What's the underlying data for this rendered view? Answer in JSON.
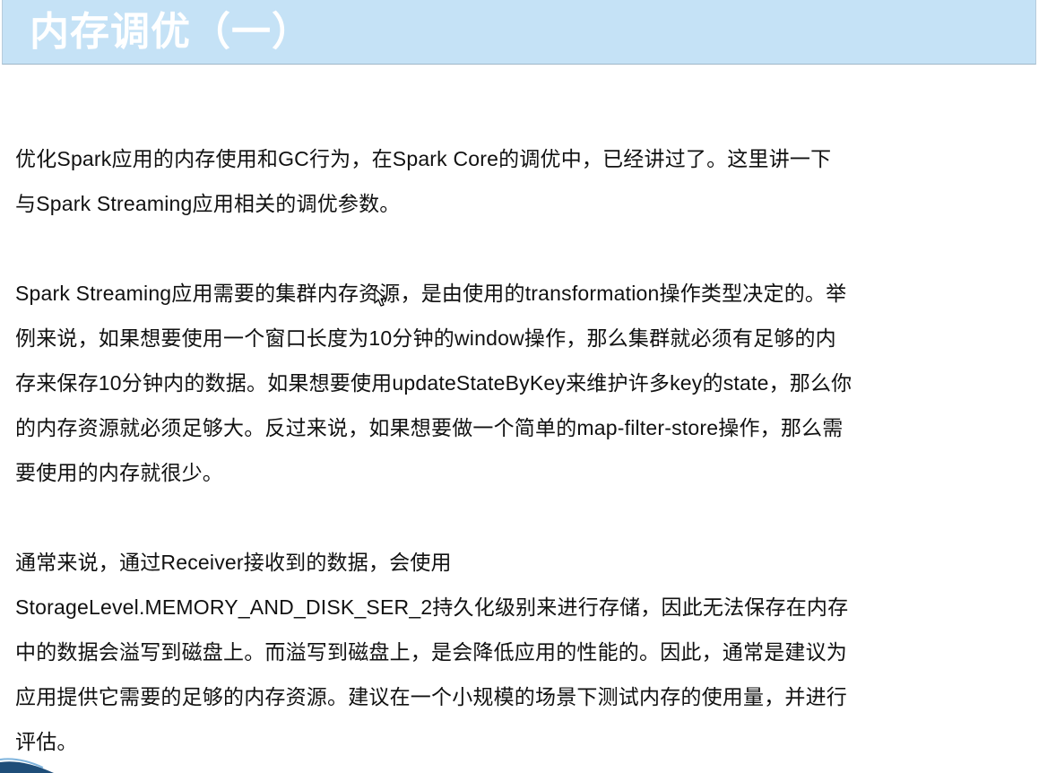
{
  "header": {
    "title": "内存调优（一）"
  },
  "paragraphs": [
    {
      "lines": [
        "优化Spark应用的内存使用和GC行为，在Spark Core的调优中，已经讲过了。这里讲一下",
        "与Spark Streaming应用相关的调优参数。"
      ]
    },
    {
      "lines": [
        "Spark Streaming应用需要的集群内存资源，是由使用的transformation操作类型决定的。举",
        "例来说，如果想要使用一个窗口长度为10分钟的window操作，那么集群就必须有足够的内",
        "存来保存10分钟内的数据。如果想要使用updateStateByKey来维护许多key的state，那么你",
        "的内存资源就必须足够大。反过来说，如果想要做一个简单的map-filter-store操作，那么需",
        "要使用的内存就很少。"
      ]
    },
    {
      "lines": [
        "通常来说，通过Receiver接收到的数据，会使用",
        "StorageLevel.MEMORY_AND_DISK_SER_2持久化级别来进行存储，因此无法保存在内存",
        "中的数据会溢写到磁盘上。而溢写到磁盘上，是会降低应用的性能的。因此，通常是建议为",
        "应用提供它需要的足够的内存资源。建议在一个小规模的场景下测试内存的使用量，并进行",
        "评估。"
      ]
    }
  ],
  "colors": {
    "title_bar_bg": "#c5e2f6",
    "title_text": "#ffffff",
    "body_text": "#111111",
    "swoosh": "#1f4e79"
  },
  "icons": {
    "cursor": "mouse-pointer-icon",
    "swoosh": "corner-swoosh-decoration"
  }
}
